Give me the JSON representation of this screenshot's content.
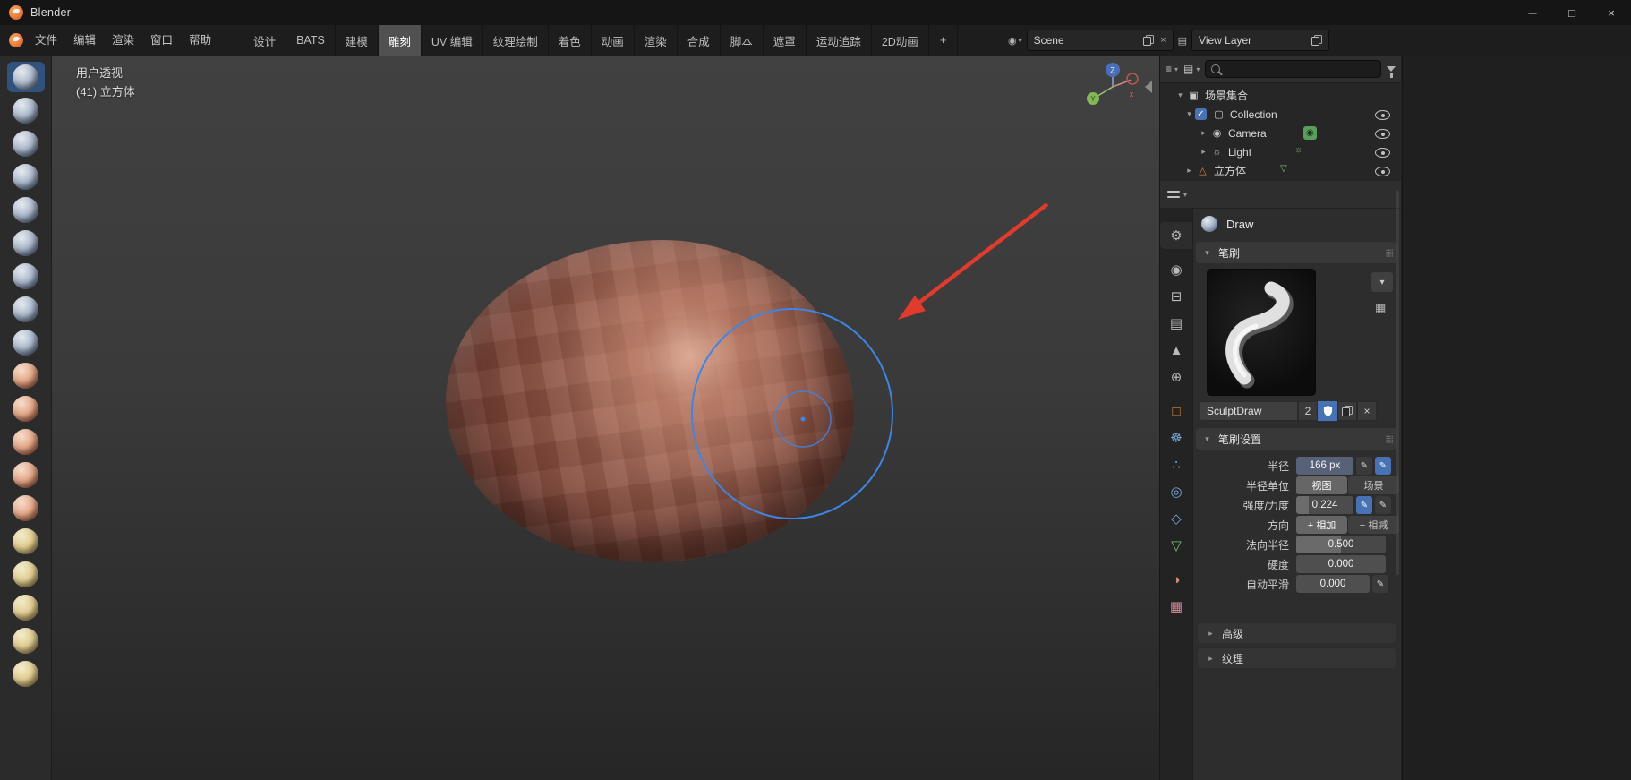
{
  "window": {
    "title": "Blender",
    "controls": {
      "minimize": "─",
      "maximize": "□",
      "close": "×"
    }
  },
  "glyphs": {
    "chevron_down": "▾",
    "tri_right": "▸",
    "tri_down": "▾",
    "check": "✓",
    "pen": "✎",
    "close": "×",
    "dots": "⣿⣿",
    "hamburger": "≡",
    "layers": "▤",
    "picture": "▦",
    "scene_ball": "◉",
    "camera": "◉",
    "light": "☼",
    "mesh": "△",
    "mesh_data": "▽",
    "collection": "▢",
    "scene_collection": "▣"
  },
  "menubar": {
    "menus": [
      "文件",
      "编辑",
      "渲染",
      "窗口",
      "帮助"
    ],
    "workspace_tabs": [
      "设计",
      "BATS",
      "建模",
      "雕刻",
      "UV 编辑",
      "纹理绘制",
      "着色",
      "动画",
      "渲染",
      "合成",
      "脚本",
      "遮罩",
      "运动追踪",
      "2D动画"
    ],
    "active_tab": "雕刻",
    "new_tab": "+",
    "scene": {
      "value": "Scene"
    },
    "view_layer": {
      "value": "View Layer"
    }
  },
  "viewport": {
    "view_mode": "用户透视",
    "object_info": "(41) 立方体",
    "axis": {
      "z": "Z",
      "y": "Y",
      "x": "x"
    }
  },
  "toolbar": {
    "brushes": [
      "draw",
      "draw-sharp",
      "clay",
      "clay-strips",
      "clay-thumb",
      "layer",
      "inflate",
      "blob",
      "crease",
      "grab",
      "elastic-deform",
      "snake-hook",
      "thumb",
      "pose",
      "cloth",
      "simplify",
      "mask",
      "draw-face-sets",
      "box-trim"
    ],
    "selected_brush": "draw"
  },
  "outliner": {
    "search_placeholder": "",
    "rows": [
      {
        "label": "场景集合"
      },
      {
        "label": "Collection"
      },
      {
        "label": "Camera"
      },
      {
        "label": "Light"
      },
      {
        "label": "立方体"
      }
    ]
  },
  "properties": {
    "tabs": [
      {
        "name": "tool",
        "glyph": "⚙"
      },
      {
        "name": "render",
        "glyph": "◉"
      },
      {
        "name": "output",
        "glyph": "⊟"
      },
      {
        "name": "view-layer",
        "glyph": "▤"
      },
      {
        "name": "scene",
        "glyph": "▲"
      },
      {
        "name": "world",
        "glyph": "⊕"
      },
      {
        "name": "object",
        "glyph": "□"
      },
      {
        "name": "modifiers",
        "glyph": "☸"
      },
      {
        "name": "particles",
        "glyph": "∴"
      },
      {
        "name": "physics",
        "glyph": "◎"
      },
      {
        "name": "constraints",
        "glyph": "◇"
      },
      {
        "name": "object-data",
        "glyph": "▽"
      },
      {
        "name": "material",
        "glyph": "◑"
      },
      {
        "name": "texture",
        "glyph": "▦"
      }
    ],
    "tool_name": "Draw",
    "brush_panel": {
      "title": "笔刷",
      "name": "SculptDraw",
      "count": "2"
    },
    "settings_panel": {
      "title": "笔刷设置",
      "radius": {
        "label": "半径",
        "value": "166 px"
      },
      "radius_unit": {
        "label": "半径单位",
        "view": "视图",
        "scene": "场景",
        "active": "视图"
      },
      "strength": {
        "label": "强度/力度",
        "value": "0.224"
      },
      "direction": {
        "label": "方向",
        "add": "+ 相加",
        "subtract": "− 相减",
        "active": "相加"
      },
      "normal_radius": {
        "label": "法向半径",
        "value": "0.500"
      },
      "hardness": {
        "label": "硬度",
        "value": "0.000"
      },
      "auto_smooth": {
        "label": "自动平滑",
        "value": "0.000"
      }
    },
    "advanced_panel": "高级",
    "texture_panel": "纹理"
  },
  "colors": {
    "accent": "#4772b3",
    "cursor_blue": "#3d85e6",
    "annotation_red": "#e23a2c",
    "object_orange": "#e0873f"
  }
}
